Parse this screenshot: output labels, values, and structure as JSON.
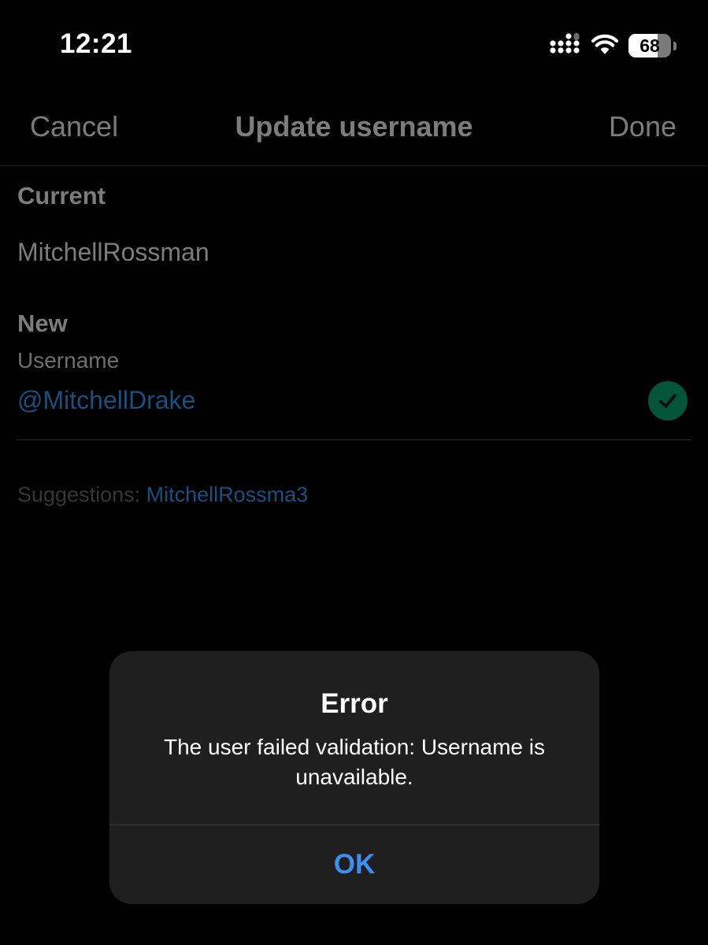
{
  "status_bar": {
    "time": "12:21",
    "battery_percent": 68,
    "battery_label": "68",
    "signal_icon": "cellular-signal-icon",
    "wifi_icon": "wifi-icon"
  },
  "nav": {
    "cancel_label": "Cancel",
    "title": "Update username",
    "done_label": "Done"
  },
  "current": {
    "heading": "Current",
    "value": "MitchellRossman"
  },
  "new": {
    "heading": "New",
    "field_label": "Username",
    "field_value": "@MitchellDrake",
    "validity_icon": "checkmark-circle-icon"
  },
  "suggestions": {
    "label": "Suggestions: ",
    "items": [
      "MitchellRossma3"
    ]
  },
  "alert": {
    "title": "Error",
    "message": "The user failed validation: Username is unavailable.",
    "ok_label": "OK"
  },
  "colors": {
    "background": "#000000",
    "dimmed_text": "#7c7c7c",
    "link_dimmed": "#1a4f7e",
    "check_green": "#03553a",
    "alert_background": "#1f1f1f",
    "alert_button": "#3f8ef0"
  }
}
